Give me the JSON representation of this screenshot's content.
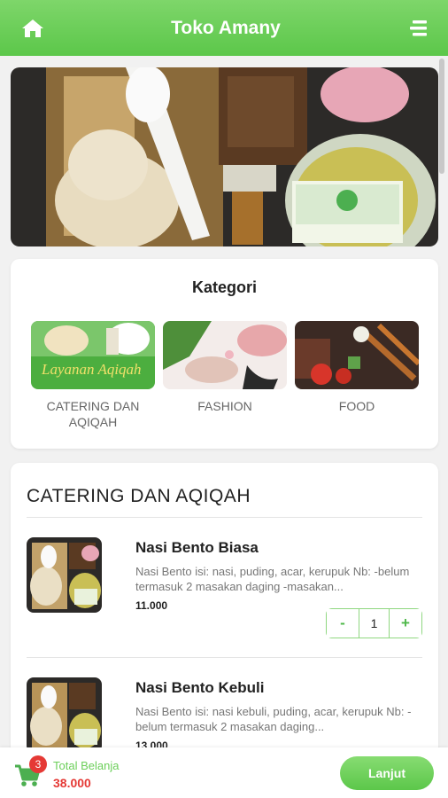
{
  "header": {
    "title": "Toko Amany",
    "home_icon": "home-icon",
    "menu_icon": "menu-icon"
  },
  "banner": {
    "alt": "Amany Aqiqah"
  },
  "kategori": {
    "title": "Kategori",
    "items": [
      {
        "label": "CATERING DAN AQIQAH"
      },
      {
        "label": "FASHION"
      },
      {
        "label": "FOOD"
      }
    ]
  },
  "catalog": {
    "title": "CATERING DAN AQIQAH",
    "products": [
      {
        "name": "Nasi Bento Biasa",
        "description": "Nasi Bento isi: nasi, puding, acar, kerupuk Nb: -belum termasuk 2 masakan daging -masakan...",
        "price": "11.000",
        "qty_minus": "-",
        "quantity": "1",
        "qty_plus": "+"
      },
      {
        "name": "Nasi Bento Kebuli",
        "description": "Nasi Bento isi: nasi kebuli, puding, acar, kerupuk Nb: -belum termasuk 2 masakan daging...",
        "price": "13.000"
      }
    ]
  },
  "cart": {
    "count": "3",
    "total_label": "Total Belanja",
    "total_value": "38.000",
    "checkout_label": "Lanjut"
  },
  "colors": {
    "primary": "#5cc74a",
    "accent_red": "#e53935"
  }
}
